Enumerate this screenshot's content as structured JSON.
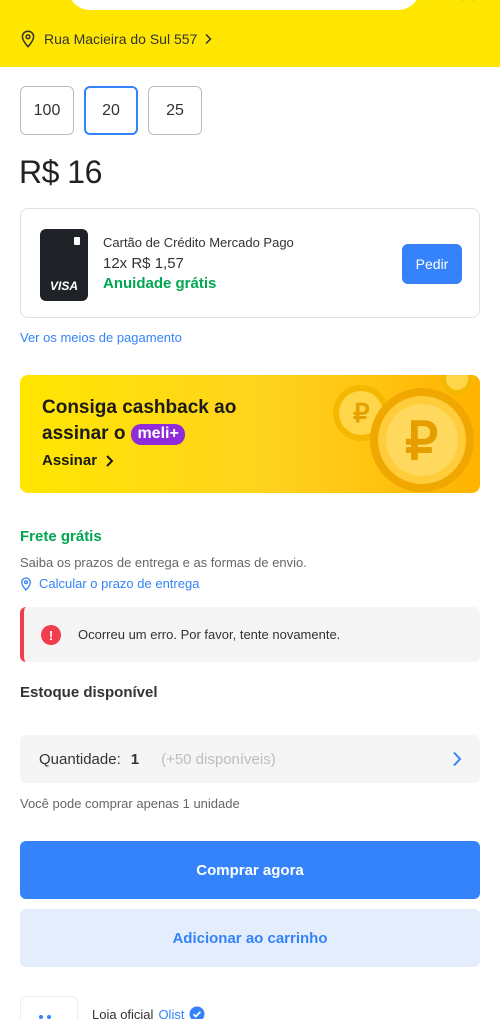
{
  "header": {
    "address": "Rua Macieira do Sul 557"
  },
  "variants": {
    "options": [
      "100",
      "20",
      "25"
    ],
    "selected": "20"
  },
  "price": "R$ 16",
  "credit_card": {
    "title": "Cartão de Crédito Mercado Pago",
    "installments": "12x R$ 1,57",
    "annual_fee": "Anuidade grátis",
    "brand": "VISA",
    "button_label": "Pedir"
  },
  "payment_link": "Ver os meios de pagamento",
  "banner": {
    "line1": "Consiga cashback ao",
    "line2": "assinar o",
    "badge": "meli+",
    "cta": "Assinar"
  },
  "shipping": {
    "title": "Frete grátis",
    "subtitle": "Saiba os prazos de entrega e as formas de envio.",
    "link": "Calcular o prazo de entrega"
  },
  "error": {
    "message": "Ocorreu um erro. Por favor, tente novamente."
  },
  "stock": {
    "title": "Estoque disponível",
    "quantity_label": "Quantidade:",
    "quantity_value": "1",
    "available": "(+50 disponíveis)",
    "limit_note": "Você pode comprar apenas 1 unidade"
  },
  "actions": {
    "buy_now": "Comprar agora",
    "add_to_cart": "Adicionar ao carrinho"
  },
  "seller": {
    "label": "Loja oficial",
    "name": "Olist"
  },
  "colors": {
    "header_yellow": "#ffe600",
    "primary_blue": "#3483fa",
    "success_green": "#00a650",
    "error_red": "#f23d4f",
    "meli_purple": "#8f2bd8"
  }
}
